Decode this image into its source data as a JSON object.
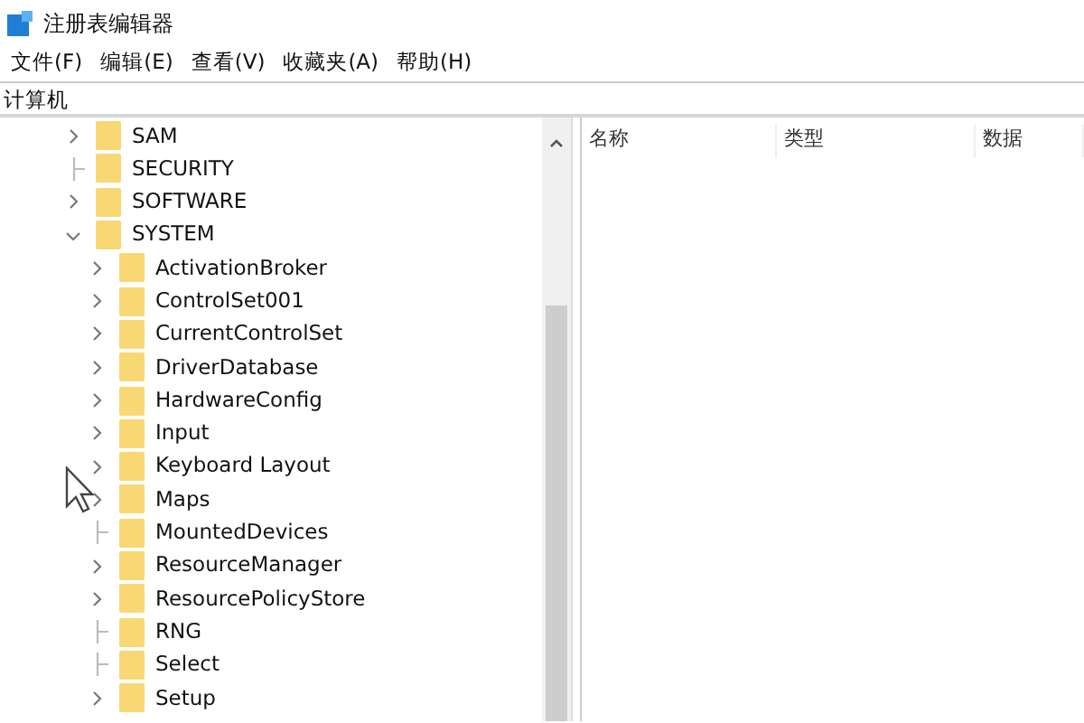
{
  "window": {
    "title": "注册表编辑器"
  },
  "menu": [
    "文件(F)",
    "编辑(E)",
    "查看(V)",
    "收藏夹(A)",
    "帮助(H)"
  ],
  "address": "计算机",
  "tree": [
    {
      "label": "SAM",
      "kind": "branch",
      "expanded": false
    },
    {
      "label": "SECURITY",
      "kind": "leaf"
    },
    {
      "label": "SOFTWARE",
      "kind": "branch",
      "expanded": false
    },
    {
      "label": "SYSTEM",
      "kind": "branch",
      "expanded": true,
      "children": [
        {
          "label": "ActivationBroker",
          "kind": "branch",
          "expanded": false
        },
        {
          "label": "ControlSet001",
          "kind": "branch",
          "expanded": false
        },
        {
          "label": "CurrentControlSet",
          "kind": "branch",
          "expanded": false
        },
        {
          "label": "DriverDatabase",
          "kind": "branch",
          "expanded": false
        },
        {
          "label": "HardwareConfig",
          "kind": "branch",
          "expanded": false
        },
        {
          "label": "Input",
          "kind": "branch",
          "expanded": false
        },
        {
          "label": "Keyboard Layout",
          "kind": "branch",
          "expanded": false
        },
        {
          "label": "Maps",
          "kind": "branch",
          "expanded": false
        },
        {
          "label": "MountedDevices",
          "kind": "leaf"
        },
        {
          "label": "ResourceManager",
          "kind": "branch",
          "expanded": false
        },
        {
          "label": "ResourcePolicyStore",
          "kind": "branch",
          "expanded": false
        },
        {
          "label": "RNG",
          "kind": "leaf"
        },
        {
          "label": "Select",
          "kind": "leaf"
        },
        {
          "label": "Setup",
          "kind": "branch",
          "expanded": false
        }
      ]
    }
  ],
  "columns": [
    "名称",
    "类型",
    "数据"
  ]
}
